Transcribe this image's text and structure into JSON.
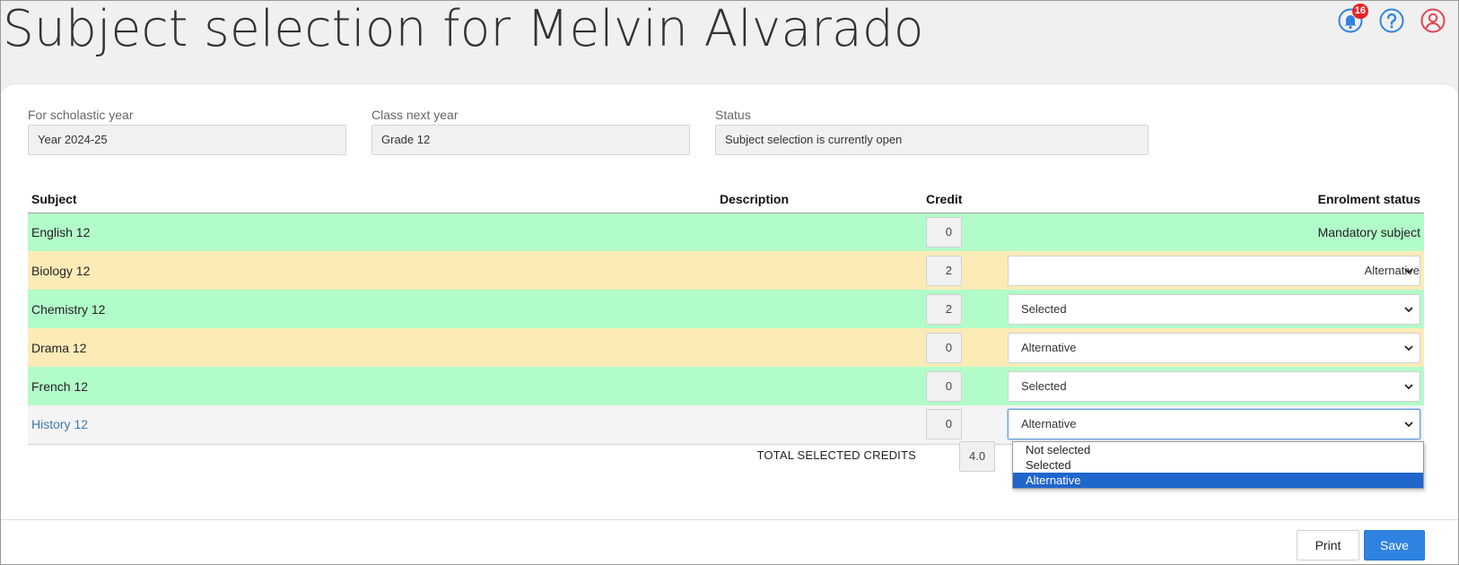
{
  "page": {
    "title": "Subject selection for Melvin Alvarado"
  },
  "topbar": {
    "notification_count": "16",
    "accent_color": "#2f83e0",
    "profile_color": "#e04553"
  },
  "fields": {
    "scholastic_year": {
      "label": "For scholastic year",
      "value": "Year 2024-25"
    },
    "class_next_year": {
      "label": "Class next year",
      "value": "Grade 12"
    },
    "status": {
      "label": "Status",
      "value": "Subject selection is currently open"
    }
  },
  "table": {
    "headers": {
      "subject": "Subject",
      "description": "Description",
      "credit": "Credit",
      "enrolment_status": "Enrolment status"
    },
    "rows": [
      {
        "subject": "English 12",
        "description": "",
        "credit": "0",
        "status": "Mandatory subject",
        "color": "#b2fcc9"
      },
      {
        "subject": "Biology 12",
        "description": "",
        "credit": "2",
        "status": "Alternative",
        "color": "#fdebb7"
      },
      {
        "subject": "Chemistry 12",
        "description": "",
        "credit": "2",
        "status": "Selected",
        "color": "#b2fcc9"
      },
      {
        "subject": "Drama 12",
        "description": "",
        "credit": "0",
        "status": "Alternative",
        "color": "#fdebb7"
      },
      {
        "subject": "French 12",
        "description": "",
        "credit": "0",
        "status": "Selected",
        "color": "#b2fcc9"
      },
      {
        "subject": "History 12",
        "description": "",
        "credit": "0",
        "status": "Alternative",
        "color": "#f4f4f4"
      }
    ]
  },
  "totals": {
    "label": "TOTAL SELECTED CREDITS",
    "value": "4.0"
  },
  "dropdown": {
    "options": [
      "Not selected",
      "Selected",
      "Alternative"
    ],
    "highlighted": "Alternative"
  },
  "footer": {
    "print_label": "Print",
    "save_label": "Save"
  }
}
